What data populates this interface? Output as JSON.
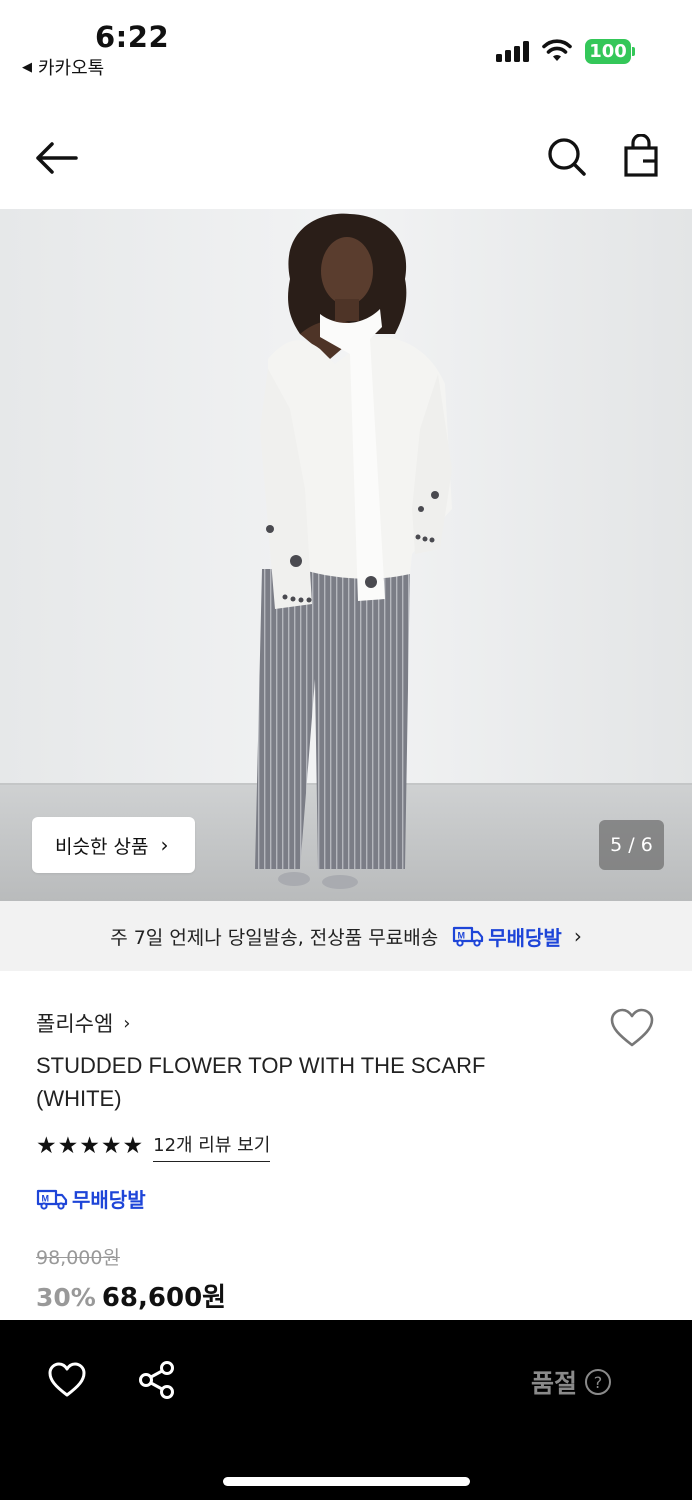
{
  "status_bar": {
    "time": "6:22",
    "back_app": "카카오톡",
    "battery": "100",
    "battery_color": "#34c759"
  },
  "nav": {
    "back_icon": "arrow-left-icon",
    "search_icon": "search-icon",
    "bag_icon": "shopping-bag-icon"
  },
  "gallery": {
    "similar_label": "비슷한 상품",
    "page_indicator": "5 / 6"
  },
  "shipping_banner": {
    "text": "주 7일 언제나 당일발송, 전상품 무료배송",
    "badge": "무배당발",
    "badge_color": "#1e45d8"
  },
  "product": {
    "brand": "폴리수엠",
    "name": "STUDDED FLOWER TOP WITH THE SCARF (WHITE)",
    "rating_stars": 5,
    "review_link": "12개 리뷰 보기",
    "free_shipping_badge": "무배당발",
    "original_price": "98,000원",
    "discount": "30%",
    "sale_price": "68,600원"
  },
  "bottom_bar": {
    "soldout_label": "품절",
    "help_symbol": "?"
  }
}
